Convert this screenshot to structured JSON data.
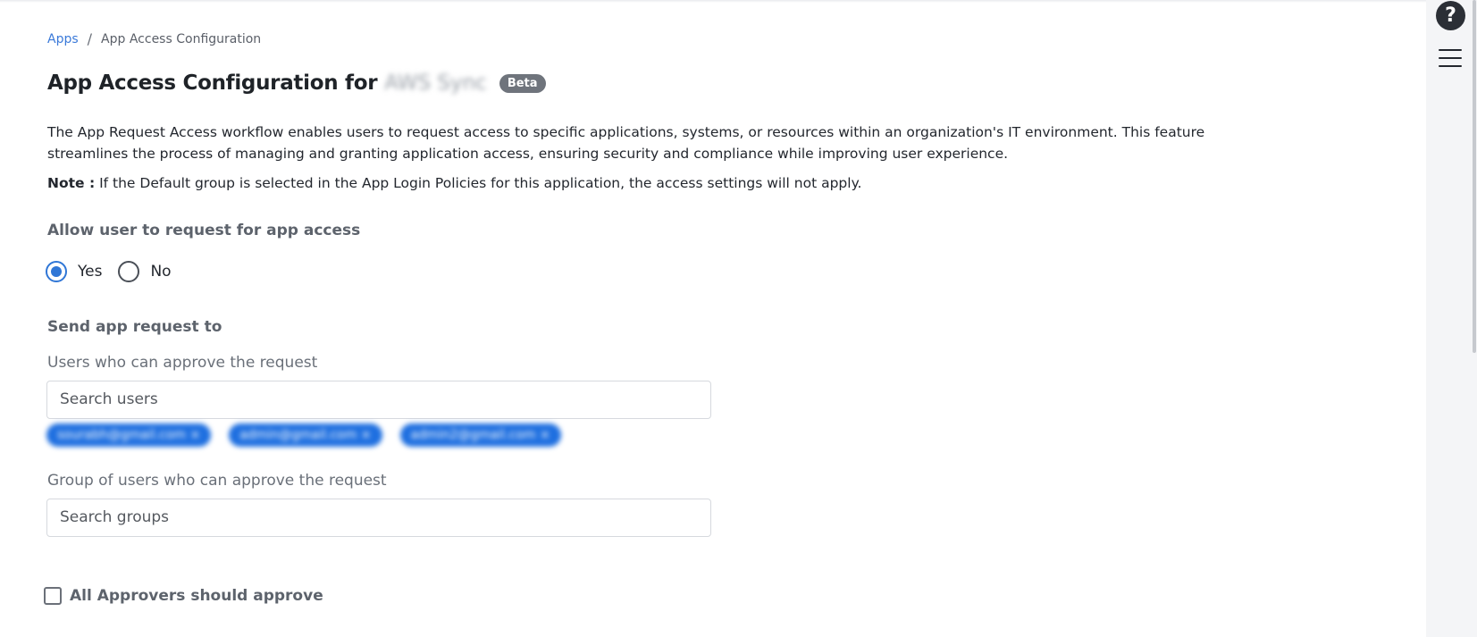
{
  "breadcrumb": {
    "apps_link": "Apps",
    "separator": "/",
    "current": "App Access Configuration"
  },
  "header": {
    "title": "App Access Configuration for",
    "app_name": "AWS Sync",
    "badge": "Beta"
  },
  "description": "The App Request Access workflow enables users to request access to specific applications, systems, or resources within an organization's IT environment. This feature streamlines the process of managing and granting application access, ensuring security and compliance while improving user experience.",
  "note": {
    "label": "Note :",
    "text": " If the Default group is selected in the App Login Policies for this application, the access settings will not apply."
  },
  "allow_request": {
    "label": "Allow user to request for app access",
    "options": [
      {
        "label": "Yes",
        "selected": true
      },
      {
        "label": "No",
        "selected": false
      }
    ]
  },
  "send_request": {
    "heading": "Send app request to",
    "users_label": "Users who can approve the request",
    "users_placeholder": "Search users",
    "selected_users": [
      "sourabh@gmail.com ×",
      "admin@gmail.com ×",
      "admin2@gmail.com ×"
    ],
    "groups_label": "Group of users who can approve the request",
    "groups_placeholder": "Search groups"
  },
  "all_approvers": {
    "label": "All Approvers should approve",
    "checked": false
  },
  "side": {
    "help": "?",
    "help_icon": "help-icon",
    "menu_icon": "hamburger-menu-icon"
  },
  "colors": {
    "accent": "#2f76d6",
    "link": "#3b7ad9",
    "chip": "#1e6fe0",
    "badge": "#6f747c"
  }
}
